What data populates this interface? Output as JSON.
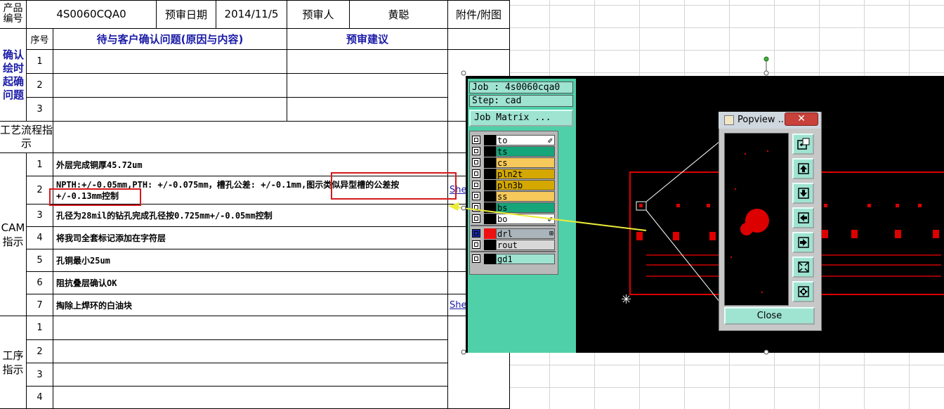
{
  "sheet": {
    "header": {
      "product_no_label": "产品编号",
      "product_no": "4S0060CQA0",
      "review_date_label": "预审日期",
      "review_date": "2014/11/5",
      "reviewer_label": "预审人",
      "reviewer": "黄聪",
      "attachment_label": "附件/附图"
    },
    "subheader": {
      "seq_label": "序号",
      "question_label": "待与客户确认问题(原因与内容)",
      "suggestion_label": "预审建议"
    },
    "confirm_section_label": "确认绘时起确问题",
    "confirm_rows": [
      "1",
      "2",
      "3"
    ],
    "process_label": "工艺流程指示",
    "cam_label": "CAM指示",
    "cam_rows": [
      {
        "no": "1",
        "text": "外层完成铜厚45.72um",
        "link": ""
      },
      {
        "no": "2",
        "text": "NPTH:+/-0.05mm,PTH: +/-0.075mm，槽孔公差: +/-0.1mm,图示类似异型槽的公差按+/-0.13mm控制",
        "link": "She"
      },
      {
        "no": "3",
        "text": "孔径为28mil的钻孔完成孔径按0.725mm+/-0.05mm控制",
        "link": ""
      },
      {
        "no": "4",
        "text": "将我司全套标记添加在字符层",
        "link": ""
      },
      {
        "no": "5",
        "text": "孔铜最小25um",
        "link": ""
      },
      {
        "no": "6",
        "text": "阻抗叠层确认OK",
        "link": ""
      },
      {
        "no": "7",
        "text": "掏除上焊环的白油块",
        "link": "She"
      }
    ],
    "procedure_label": "工序指示",
    "procedure_rows": [
      "1",
      "2",
      "3",
      "4"
    ]
  },
  "app": {
    "job_line": "Job : 4s0060cqa0",
    "step_line": "Step: cad",
    "job_matrix_button": "Job Matrix ...",
    "layers": [
      {
        "name": "to",
        "color": "#ffffff",
        "marker": "✐"
      },
      {
        "name": "ts",
        "color": "#17a57a"
      },
      {
        "name": "cs",
        "color": "#f7c95a"
      },
      {
        "name": "pln2t",
        "color": "#d4a800"
      },
      {
        "name": "pln3b",
        "color": "#d4a800"
      },
      {
        "name": "ss",
        "color": "#f7c95a"
      },
      {
        "name": "bs",
        "color": "#17a57a"
      },
      {
        "name": "bo",
        "color": "#ffffff",
        "marker": "✐"
      }
    ],
    "drill_layers": [
      {
        "name": "drl",
        "color": "#a9b4bb",
        "active_color": "#ee1111",
        "marker": "⊞"
      },
      {
        "name": "rout",
        "color": "#d8d8d8"
      }
    ],
    "extra_layers": [
      {
        "name": "gd1",
        "color": "#9fe3d1"
      }
    ]
  },
  "popview": {
    "title": "Popview ...",
    "close_x": "✕",
    "close_button": "Close",
    "tools": [
      "zoom-window-icon",
      "pan-up-icon",
      "pan-down-icon",
      "pan-left-icon",
      "pan-right-icon",
      "zoom-in-icon",
      "zoom-out-icon"
    ]
  },
  "colors": {
    "app_green": "#4fd0a9",
    "button_aqua": "#9fe3d1",
    "highlight_red": "#d6191b",
    "arrow_yellow": "#ecec3a",
    "pcb_red": "#dd0000"
  }
}
